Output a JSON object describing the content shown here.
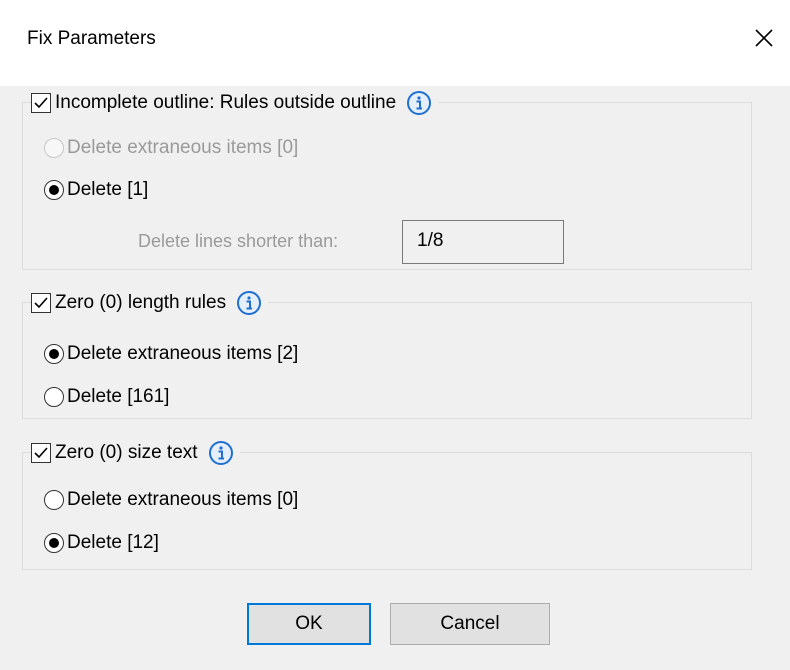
{
  "dialog": {
    "title": "Fix Parameters",
    "close_icon": "close-icon"
  },
  "groups": [
    {
      "title": "Incomplete outline: Rules outside outline",
      "checked": true,
      "info_icon": "info-icon",
      "options": [
        {
          "label": "Delete extraneous items [0]",
          "selected": false,
          "disabled": true
        },
        {
          "label": "Delete [1]",
          "selected": true,
          "disabled": false
        }
      ],
      "field": {
        "label": "Delete lines shorter than:",
        "value": "1/8"
      }
    },
    {
      "title": "Zero (0) length rules",
      "checked": true,
      "info_icon": "info-icon",
      "options": [
        {
          "label": "Delete extraneous items [2]",
          "selected": true,
          "disabled": false
        },
        {
          "label": "Delete [161]",
          "selected": false,
          "disabled": false
        }
      ]
    },
    {
      "title": "Zero (0) size text",
      "checked": true,
      "info_icon": "info-icon",
      "options": [
        {
          "label": "Delete extraneous items [0]",
          "selected": false,
          "disabled": false
        },
        {
          "label": "Delete [12]",
          "selected": true,
          "disabled": false
        }
      ]
    }
  ],
  "buttons": {
    "ok": "OK",
    "cancel": "Cancel"
  },
  "colors": {
    "accent": "#0078d7",
    "info_icon": "#1e6fd0",
    "dialog_bg": "#f0f0f0"
  }
}
